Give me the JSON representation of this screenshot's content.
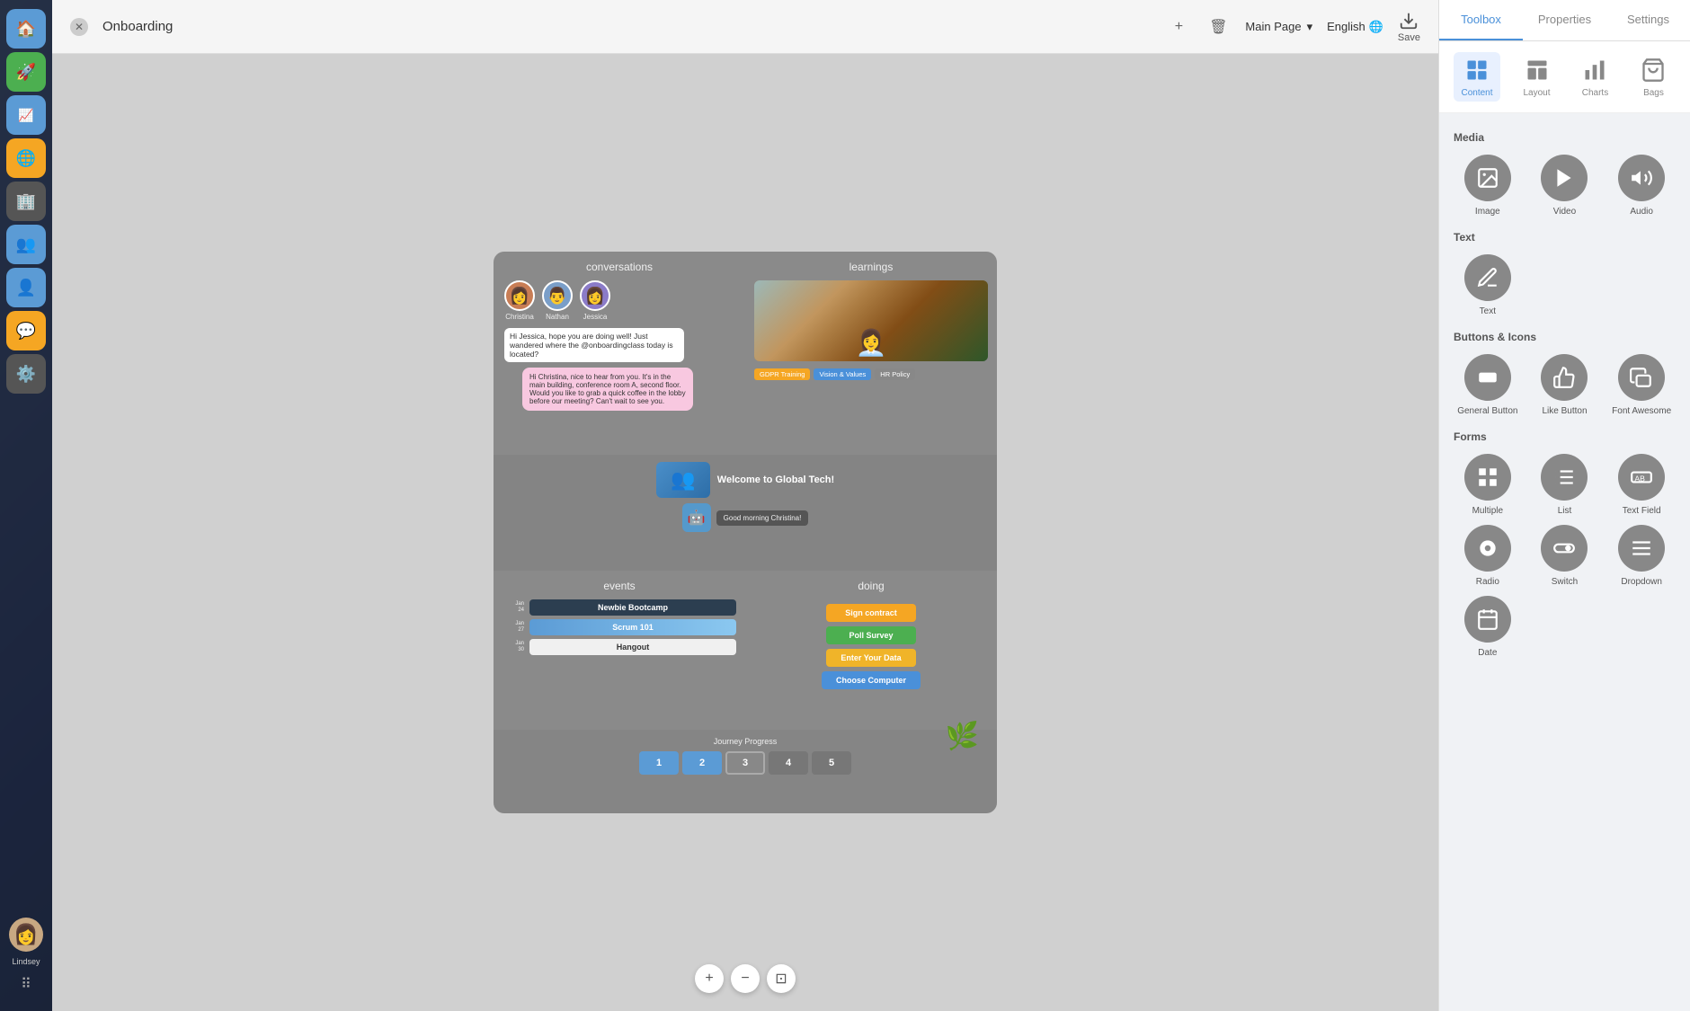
{
  "app": {
    "title": "Onboarding"
  },
  "topbar": {
    "title": "Onboarding",
    "page": "Main Page",
    "lang": "English",
    "save": "Save",
    "add_icon": "+",
    "delete_icon": "🗑"
  },
  "sidebar": {
    "items": [
      {
        "id": "home",
        "icon": "🏠",
        "label": "Home"
      },
      {
        "id": "rocket",
        "icon": "🚀",
        "label": "Launch"
      },
      {
        "id": "trend",
        "icon": "📈",
        "label": "Analytics"
      },
      {
        "id": "globe",
        "icon": "🌐",
        "label": "Global"
      },
      {
        "id": "building",
        "icon": "🏢",
        "label": "Organization"
      },
      {
        "id": "group",
        "icon": "👥",
        "label": "Groups"
      },
      {
        "id": "person",
        "icon": "👤",
        "label": "Profile"
      },
      {
        "id": "chat",
        "icon": "💬",
        "label": "Messages"
      },
      {
        "id": "settings",
        "icon": "⚙️",
        "label": "Settings"
      }
    ],
    "user": {
      "name": "Lindsey",
      "avatar": "👩"
    }
  },
  "canvas": {
    "panels": {
      "conversations": {
        "title": "conversations",
        "avatars": [
          {
            "name": "Christina",
            "emoji": "👩"
          },
          {
            "name": "Nathan",
            "emoji": "👨"
          },
          {
            "name": "Jessica",
            "emoji": "👩"
          }
        ],
        "message": "Hi Jessica, hope you are doing well! Just wandered where the @onboardingclass today is located?",
        "reply": "Hi Christina, nice to hear from you. It's in the main building, conference room A, second floor. Would you like to grab a quick coffee in the lobby before our meeting? Can't wait to see you."
      },
      "learnings": {
        "title": "learnings",
        "tags": [
          {
            "label": "GDPR Training",
            "color": "orange"
          },
          {
            "label": "Vision & Values",
            "color": "blue"
          },
          {
            "label": "HR Policy",
            "color": "gray"
          }
        ]
      },
      "welcome": {
        "title": "Welcome to Global Tech!",
        "robot_message": "Good morning Christina!"
      },
      "events": {
        "title": "events",
        "items": [
          {
            "date": "Jan 24",
            "label": "Newbie Bootcamp",
            "type": "dark"
          },
          {
            "date": "Jan 27",
            "label": "Scrum 101",
            "type": "image"
          },
          {
            "date": "Jan 30",
            "label": "Hangout",
            "type": "light"
          }
        ]
      },
      "doing": {
        "title": "doing",
        "buttons": [
          {
            "label": "Sign contract",
            "color": "orange"
          },
          {
            "label": "Poll Survey",
            "color": "green"
          },
          {
            "label": "Enter Your Data",
            "color": "yellow"
          },
          {
            "label": "Choose Computer",
            "color": "blue"
          }
        ]
      },
      "progress": {
        "label": "Journey Progress",
        "steps": [
          "1",
          "2",
          "3",
          "4",
          "5"
        ]
      }
    },
    "controls": {
      "zoom_in": "+",
      "zoom_out": "−",
      "fit": "⊡"
    }
  },
  "toolbox": {
    "tabs": [
      {
        "label": "Toolbox",
        "active": true
      },
      {
        "label": "Properties",
        "active": false
      },
      {
        "label": "Settings",
        "active": false
      }
    ],
    "nav": [
      {
        "label": "Content",
        "icon": "⬜",
        "active": true
      },
      {
        "label": "Layout",
        "icon": "▦",
        "active": false
      },
      {
        "label": "Charts",
        "icon": "📊",
        "active": false
      },
      {
        "label": "Bags",
        "icon": "🛍",
        "active": false
      }
    ],
    "sections": {
      "media": {
        "title": "Media",
        "items": [
          {
            "label": "Image",
            "icon": "🖼"
          },
          {
            "label": "Video",
            "icon": "▶"
          },
          {
            "label": "Audio",
            "icon": "🔊"
          }
        ]
      },
      "text": {
        "title": "Text",
        "items": [
          {
            "label": "Text",
            "icon": "✏️"
          }
        ]
      },
      "buttons": {
        "title": "Buttons & Icons",
        "items": [
          {
            "label": "General Button",
            "icon": "⬛"
          },
          {
            "label": "Like Button",
            "icon": "👍"
          },
          {
            "label": "Font Awesome",
            "icon": "🚗"
          }
        ]
      },
      "forms": {
        "title": "Forms",
        "items": [
          {
            "label": "Multiple",
            "icon": "▦"
          },
          {
            "label": "List",
            "icon": "≡"
          },
          {
            "label": "Text Field",
            "icon": "🔤"
          },
          {
            "label": "Radio",
            "icon": "⬤"
          },
          {
            "label": "Switch",
            "icon": "⏺"
          },
          {
            "label": "Dropdown",
            "icon": "☰"
          },
          {
            "label": "Date",
            "icon": "📅"
          }
        ]
      }
    }
  }
}
